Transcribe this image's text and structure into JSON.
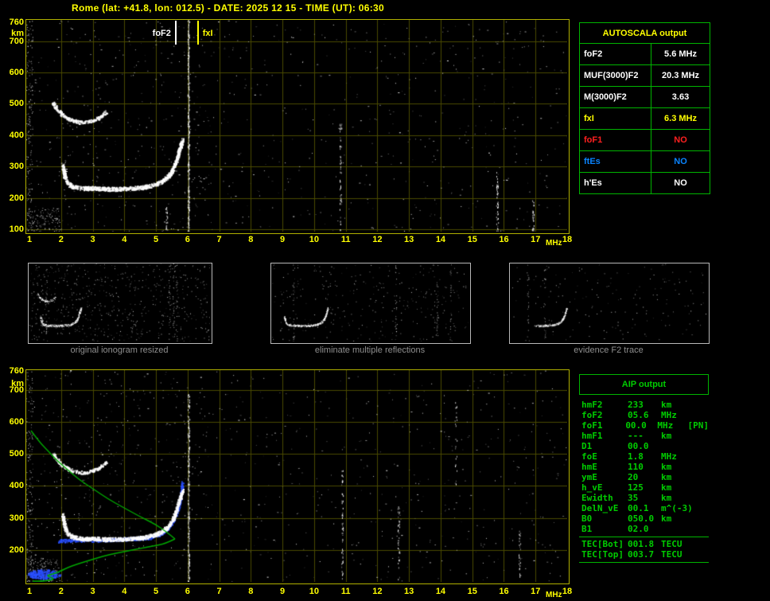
{
  "header": {
    "title": "Rome (lat: +41.8, lon: 012.5) - DATE: 2025 12 15 - TIME (UT): 06:30"
  },
  "top_plot": {
    "y_unit": "km",
    "x_unit": "MHz",
    "y_ticks": [
      "760",
      "700",
      "600",
      "500",
      "400",
      "300",
      "200",
      "100"
    ],
    "x_ticks": [
      "1",
      "2",
      "3",
      "4",
      "5",
      "6",
      "7",
      "8",
      "9",
      "10",
      "11",
      "12",
      "13",
      "14",
      "15",
      "16",
      "17",
      "18"
    ],
    "markers": [
      {
        "label": "foF2",
        "freq_mhz": 5.6,
        "color": "#ffffff"
      },
      {
        "label": "fxI",
        "freq_mhz": 6.3,
        "color": "#ffff00"
      }
    ]
  },
  "autoscala": {
    "title": "AUTOSCALA output",
    "rows": [
      {
        "param": "foF2",
        "value": "5.6 MHz",
        "color": "#ffffff"
      },
      {
        "param": "MUF(3000)F2",
        "value": "20.3 MHz",
        "color": "#ffffff"
      },
      {
        "param": "M(3000)F2",
        "value": "3.63",
        "color": "#ffffff"
      },
      {
        "param": "fxI",
        "value": "6.3 MHz",
        "color": "#ffff00"
      },
      {
        "param": "foF1",
        "value": "NO",
        "color": "#ff2020"
      },
      {
        "param": "ftEs",
        "value": "NO",
        "color": "#0a84ff"
      },
      {
        "param": "h'Es",
        "value": "NO",
        "color": "#ffffff"
      }
    ]
  },
  "thumbnails": [
    {
      "caption": "original ionogram resized"
    },
    {
      "caption": "eliminate multiple reflections"
    },
    {
      "caption": "evidence F2 trace"
    }
  ],
  "bottom_plot": {
    "y_unit": "km",
    "x_unit": "MHz",
    "y_ticks": [
      "760",
      "700",
      "600",
      "500",
      "400",
      "300",
      "200"
    ],
    "x_ticks": [
      "1",
      "2",
      "3",
      "4",
      "5",
      "6",
      "7",
      "8",
      "9",
      "10",
      "11",
      "12",
      "13",
      "14",
      "15",
      "16",
      "17",
      "18"
    ]
  },
  "aip": {
    "title": "AIP output",
    "rows": [
      {
        "param": "hmF2",
        "value": "233",
        "unit": "km",
        "note": ""
      },
      {
        "param": "foF2",
        "value": "05.6",
        "unit": "MHz",
        "note": ""
      },
      {
        "param": "foF1",
        "value": "00.0",
        "unit": "MHz",
        "note": "[PN]"
      },
      {
        "param": "hmF1",
        "value": "---",
        "unit": "km",
        "note": ""
      },
      {
        "param": "D1",
        "value": "00.0",
        "unit": "",
        "note": ""
      },
      {
        "param": "foE",
        "value": "1.8",
        "unit": "MHz",
        "note": ""
      },
      {
        "param": "hmE",
        "value": "110",
        "unit": "km",
        "note": ""
      },
      {
        "param": "ymE",
        "value": "20",
        "unit": "km",
        "note": ""
      },
      {
        "param": "h_vE",
        "value": "125",
        "unit": "km",
        "note": ""
      },
      {
        "param": "Ewidth",
        "value": "35",
        "unit": "km",
        "note": ""
      },
      {
        "param": "DelN_vE",
        "value": "00.1",
        "unit": "m^(-3)",
        "note": ""
      },
      {
        "param": "B0",
        "value": "050.0",
        "unit": "km",
        "note": ""
      },
      {
        "param": "B1",
        "value": "02.0",
        "unit": "",
        "note": ""
      }
    ],
    "tec_rows": [
      {
        "param": "TEC[Bot]",
        "value": "001.8",
        "unit": "TECU"
      },
      {
        "param": "TEC[Top]",
        "value": "003.7",
        "unit": "TECU"
      }
    ]
  },
  "colors": {
    "accent_yellow": "#ffff00",
    "grid": "#4a4a00",
    "plot_border": "#b0b000",
    "table_green": "#00b400",
    "aip_text": "#00cc00",
    "profile_green": "#00a800",
    "trace_blue": "#2a50ff",
    "caption_gray": "#8f8f8f"
  }
}
